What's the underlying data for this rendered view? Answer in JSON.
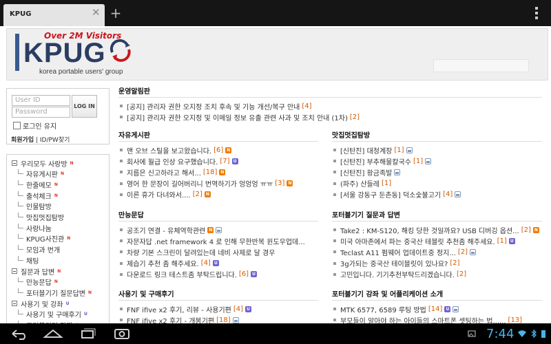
{
  "browser": {
    "tab_title": "KPUG",
    "tab_close": "✕",
    "new_tab": "+"
  },
  "header": {
    "logo_tagline": "Over 2M Visitors",
    "logo_main": "KPUG",
    "logo_sub": "korea portable users' group"
  },
  "login": {
    "id_placeholder": "User ID",
    "pw_placeholder": "Password",
    "login_button": "LOG IN",
    "keep_login": "로그인 유지",
    "join": "회원가입",
    "find": " | ID/PW찾기"
  },
  "sidebar": {
    "items": [
      {
        "label": "우리모두 사랑방",
        "level": "top",
        "badge": "N"
      },
      {
        "label": "자유게시판",
        "level": "sub",
        "badge": "N"
      },
      {
        "label": "한줄메모",
        "level": "sub",
        "badge": "N"
      },
      {
        "label": "출석체크",
        "level": "sub",
        "badge": "N"
      },
      {
        "label": "인물탐방",
        "level": "sub",
        "badge": ""
      },
      {
        "label": "맛집멋집탐방",
        "level": "sub",
        "badge": ""
      },
      {
        "label": "사랑나눔",
        "level": "sub",
        "badge": ""
      },
      {
        "label": "KPUG사진관",
        "level": "sub",
        "badge": "N"
      },
      {
        "label": "모임과 번개",
        "level": "sub",
        "badge": ""
      },
      {
        "label": "채팅",
        "level": "sub",
        "badge": ""
      },
      {
        "label": "질문과 답변",
        "level": "top",
        "badge": "N"
      },
      {
        "label": "만능문답",
        "level": "sub",
        "badge": "N"
      },
      {
        "label": "포터블기기 질문답변",
        "level": "sub",
        "badge": "N"
      },
      {
        "label": "사용기 및 강좌",
        "level": "top",
        "badge": "U"
      },
      {
        "label": "사용기 및 구매후기",
        "level": "sub",
        "badge": "U"
      },
      {
        "label": "포터블기기 강좌",
        "level": "sub",
        "badge": "U"
      }
    ]
  },
  "content": {
    "notice": {
      "title": "운영알림판",
      "posts": [
        {
          "text": "[공지] 관리자 권한 오지정 조치 후속 및 기능 개선/복구 안내",
          "count": "[4]",
          "icons": []
        },
        {
          "text": "[공지] 관리자 권한 오지정 및 이메일 정보 유출 관련 사과 및 조치 안내 (1차)",
          "count": "[2]",
          "icons": []
        }
      ]
    },
    "free": {
      "title": "자유게시판",
      "posts": [
        {
          "text": "맨 오브 스틸을 보고왔습니다.",
          "count": "[6]",
          "icons": [
            "new"
          ]
        },
        {
          "text": "회사에 월급 인상 요구했습니다.",
          "count": "[7]",
          "icons": [
            "upd"
          ]
        },
        {
          "text": "지름은 신고하라고 해서...",
          "count": "[18]",
          "icons": [
            "new"
          ]
        },
        {
          "text": "영어 한 문장이 길어버리니 번역하기가 엉엉엉 ㅠㅠ",
          "count": "[3]",
          "icons": [
            "new"
          ]
        },
        {
          "text": "이른 휴가 다녀와서....",
          "count": "[2]",
          "icons": [
            "new"
          ]
        }
      ]
    },
    "food": {
      "title": "맛집멋집탐방",
      "posts": [
        {
          "text": "[신탄진] 대청계장",
          "count": "[1]",
          "icons": [
            "img"
          ]
        },
        {
          "text": "[신탄진] 부추해물칼국수",
          "count": "[1]",
          "icons": [
            "img"
          ]
        },
        {
          "text": "[신탄진] 황금족발",
          "count": "",
          "icons": [
            "img"
          ]
        },
        {
          "text": "(파주) 산들레",
          "count": "[1]",
          "icons": []
        },
        {
          "text": "[서울 강동구 둔촌동] 덕소숯불고기",
          "count": "[4]",
          "icons": [
            "img"
          ]
        }
      ]
    },
    "qa": {
      "title": "만능문답",
      "posts": [
        {
          "text": "공조기 연결 - 유체역학관련",
          "count": "",
          "icons": [
            "new",
            "img"
          ]
        },
        {
          "text": "자문자답 .net framework 4 로 인해 무한반복 윈도우업데...",
          "count": "",
          "icons": []
        },
        {
          "text": "차량 기본 스크린이 달려있는데 네비 사제로 달 경우",
          "count": "",
          "icons": []
        },
        {
          "text": "제습기 추천 좀 해주세요.",
          "count": "[4]",
          "icons": [
            "upd"
          ]
        },
        {
          "text": "다운로드 링크 테스트좀 부탁드립니다.",
          "count": "[6]",
          "icons": [
            "upd"
          ]
        }
      ]
    },
    "portable_qa": {
      "title": "포터블기기 질문과 답변",
      "posts": [
        {
          "text": "Take2 : KM-S120, 해킹 당한 것일까요? USB 디버깅 옵션...",
          "count": "[2]",
          "icons": [
            "new"
          ]
        },
        {
          "text": "미국 아마존에서 파는 중국산 테블릿 추천좀 해주세요.",
          "count": "[1]",
          "icons": [
            "upd"
          ]
        },
        {
          "text": "Teclast A11 펌웨어 업데이트중 정지...",
          "count": "[2]",
          "icons": [
            "img"
          ]
        },
        {
          "text": "3g가되는 중국산 테이블릿이 있나요?",
          "count": "[2]",
          "icons": []
        },
        {
          "text": "고민입니다. 기기추천부탁드리겠습니다.",
          "count": "[2]",
          "icons": []
        }
      ]
    },
    "reviews": {
      "title": "사용기 및 구매후기",
      "posts": [
        {
          "text": "FNF ifive x2 후기, 리뷰 - 사용기편",
          "count": "[4]",
          "icons": [
            "upd"
          ]
        },
        {
          "text": "FNF ifive x2 후기 - 개봉기편",
          "count": "[18]",
          "icons": [
            "img"
          ]
        }
      ]
    },
    "guides": {
      "title": "포터블기기 강좌 및 어플리케이션 소개",
      "posts": [
        {
          "text": "MTK 6577, 6589 루팅 방법",
          "count": "[14]",
          "icons": [
            "upd",
            "img"
          ]
        },
        {
          "text": "부모들이 알아야 하는 아이들의 스마트폰 셋팅하는 법......",
          "count": "[13]",
          "icons": []
        }
      ]
    }
  },
  "status": {
    "clock": "7:44"
  },
  "colors": {
    "accent": "#d55a00",
    "clock": "#4bb3e8",
    "new_icon": "#f07c00",
    "update_icon": "#6f62d1"
  }
}
